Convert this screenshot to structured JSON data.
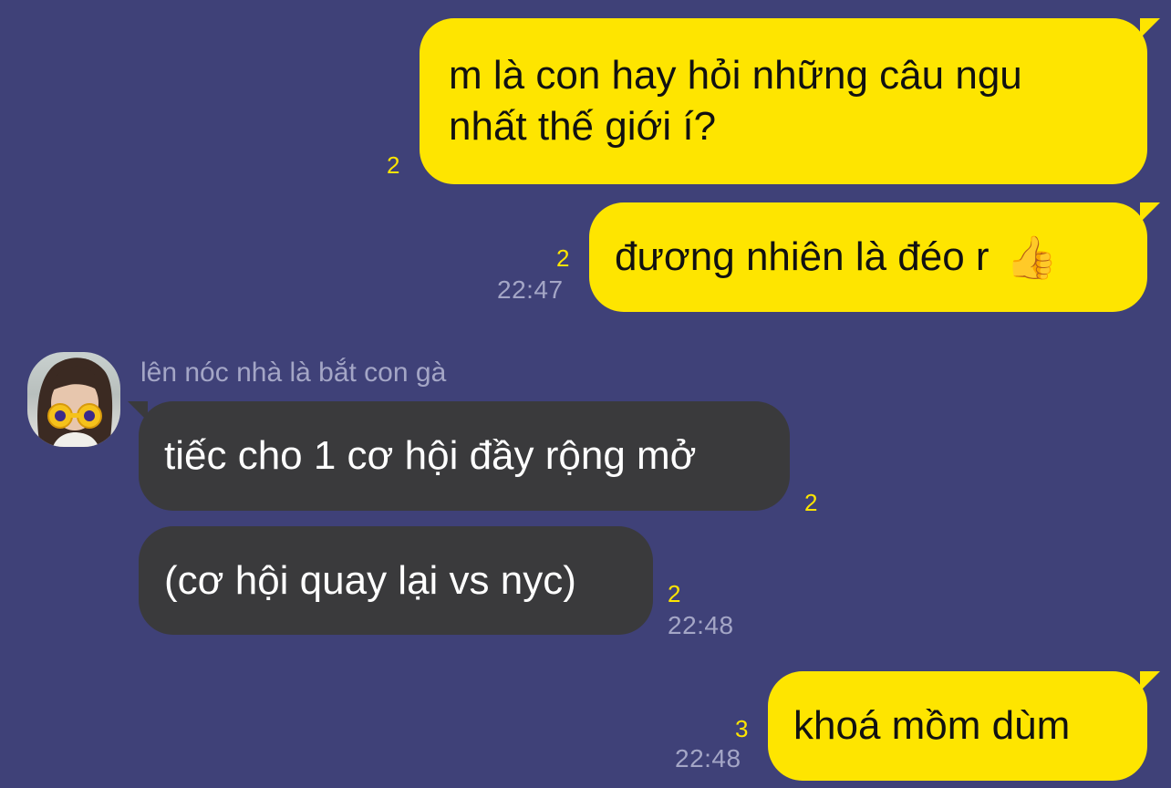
{
  "messages": [
    {
      "text_lines": [
        "m là con hay hỏi những câu ngu",
        "nhất thế giới í?"
      ],
      "unread": "2"
    },
    {
      "text": "đương nhiên là đéo r",
      "emoji": "👍",
      "unread": "2",
      "time": "22:47"
    },
    {
      "sender": "lên nóc nhà là bắt con gà",
      "text": "tiếc cho 1 cơ hội đầy rộng mở",
      "unread": "2"
    },
    {
      "text": "(cơ hội quay lại vs nyc)",
      "unread": "2",
      "time": "22:48"
    },
    {
      "text": "khoá mồm dùm",
      "unread": "3",
      "time": "22:48"
    }
  ],
  "colors": {
    "background": "#3f4178",
    "outgoing_bubble": "#fee500",
    "incoming_bubble": "#3a3a3c",
    "unread_count": "#fee500",
    "meta_text": "#a4a6c6"
  },
  "avatar": {
    "icon": "avatar-girl-with-toy-glasses"
  }
}
